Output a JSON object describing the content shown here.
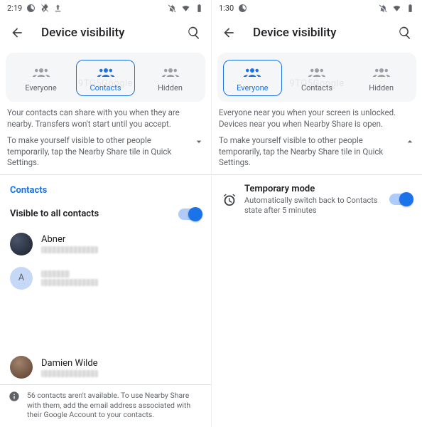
{
  "left": {
    "status": {
      "time": "2:19"
    },
    "app_title": "Device visibility",
    "tabs": {
      "everyone": "Everyone",
      "contacts": "Contacts",
      "hidden": "Hidden",
      "selected": "contacts"
    },
    "watermark": "9TO5Google",
    "desc_main": "Your contacts can share with you when they are nearby. Transfers won't start until you accept.",
    "desc_expand": "To make yourself visible to other people temporarily, tap the Nearby Share tile in Quick Settings.",
    "section_label": "Contacts",
    "visible_all": {
      "label": "Visible to all contacts",
      "on": true
    },
    "contacts": {
      "a": {
        "name": "Abner"
      },
      "b": {
        "initial": "A"
      },
      "c": {
        "name": "Damien Wilde"
      }
    },
    "unavailable_note": "56 contacts aren't available. To use Nearby Share with them, add the email address associated with their Google Account to your contacts."
  },
  "right": {
    "status": {
      "time": "1:30"
    },
    "app_title": "Device visibility",
    "tabs": {
      "everyone": "Everyone",
      "contacts": "Contacts",
      "hidden": "Hidden",
      "selected": "everyone"
    },
    "watermark": "9TO5Google",
    "desc_main": "Everyone near you when your screen is unlocked. Devices near you when Nearby Share is open.",
    "desc_expand": "To make yourself visible to other people temporarily, tap the Nearby Share tile in Quick Settings.",
    "temp_mode": {
      "title": "Temporary mode",
      "subtitle": "Automatically switch back to Contacts state after 5 minutes",
      "on": true
    }
  }
}
